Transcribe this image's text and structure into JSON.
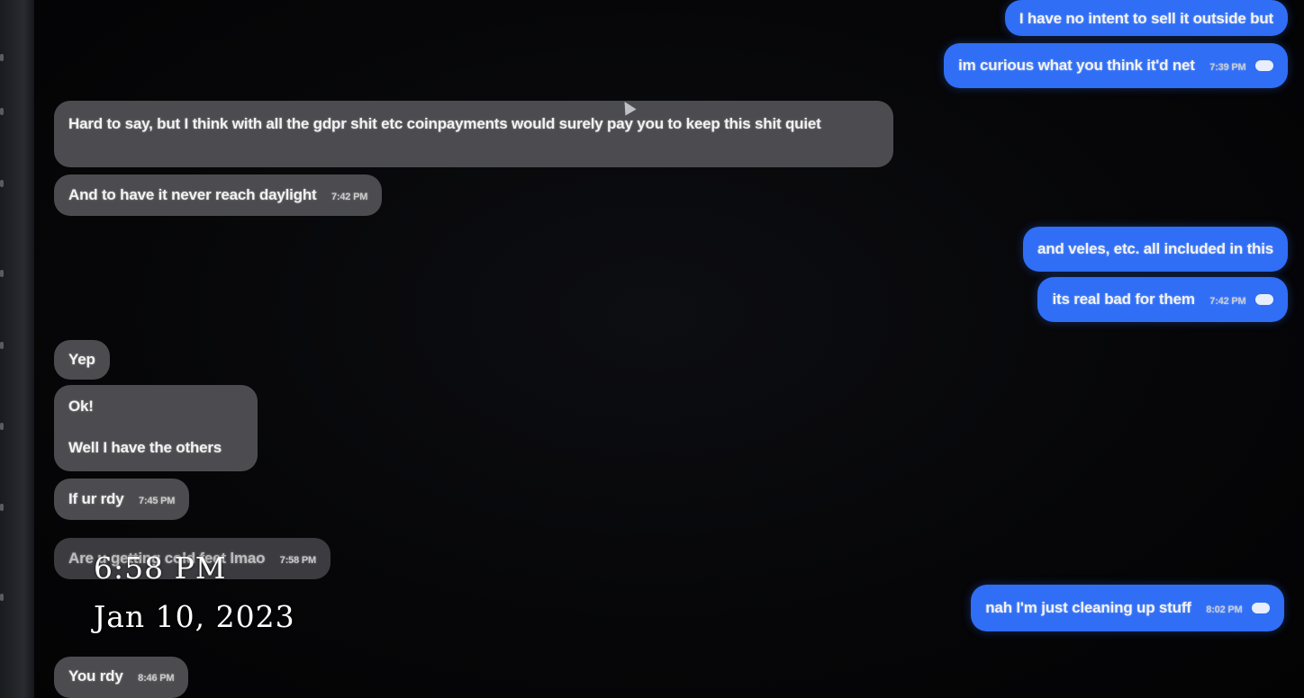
{
  "messages": [
    {
      "id": "m1",
      "side": "out",
      "text": "I have no intent to sell it outside but",
      "time": ""
    },
    {
      "id": "m2",
      "side": "out",
      "text": "im curious what you think it'd net",
      "time": "7:39 PM",
      "read_icon": "read-receipt-icon"
    },
    {
      "id": "m3",
      "side": "in",
      "text": "Hard to say, but I think with all the gdpr shit etc coinpayments would surely pay you to keep this shit quiet",
      "time": ""
    },
    {
      "id": "m4",
      "side": "in",
      "text": "And to have it never reach daylight",
      "time": "7:42 PM"
    },
    {
      "id": "m5",
      "side": "out",
      "text": "and veles, etc. all included in this",
      "time": ""
    },
    {
      "id": "m6",
      "side": "out",
      "text": "its real bad for them",
      "time": "7:42 PM",
      "read_icon": "read-receipt-icon"
    },
    {
      "id": "m7",
      "side": "in",
      "text": "Yep",
      "time": ""
    },
    {
      "id": "m8",
      "side": "in",
      "text": "Ok!",
      "text2": "Well I have the others",
      "time": ""
    },
    {
      "id": "m9",
      "side": "in",
      "text": "If ur rdy",
      "time": "7:45 PM"
    },
    {
      "id": "m10",
      "side": "in",
      "text": "Are u getting cold feet lmao",
      "time": "7:58 PM"
    },
    {
      "id": "m11",
      "side": "out",
      "text": "nah I'm just cleaning up stuff",
      "time": "8:02 PM",
      "read_icon": "read-receipt-icon"
    },
    {
      "id": "m12",
      "side": "in",
      "text": "You rdy",
      "time": "8:46 PM"
    }
  ],
  "overlay": {
    "time": "6:58 PM",
    "date": "Jan 10, 2023"
  },
  "colors": {
    "incoming_bubble": "#4c4c50",
    "outgoing_bubble": "#2f6ef5",
    "background": "#050506"
  }
}
